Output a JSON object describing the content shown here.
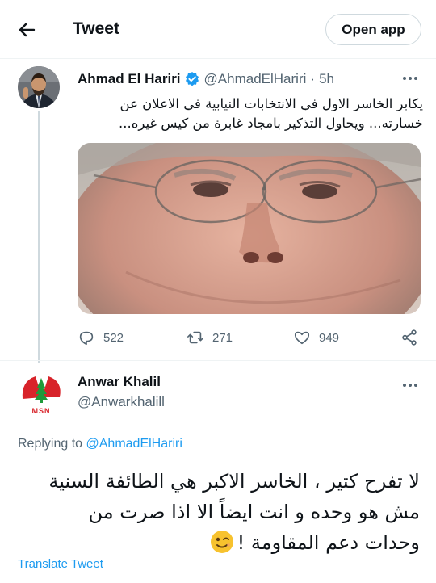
{
  "header": {
    "title": "Tweet",
    "open_app_label": "Open app"
  },
  "tweet": {
    "author_name": "Ahmad El Hariri",
    "handle": "@AhmadElHariri",
    "separator": "·",
    "time": "5h",
    "text_line1": "يكابر الخاسر الاول في الانتخابات النيابية في الاعلان عن",
    "text_line2": "خسارته... ويحاول التذكير بامجاد غابرة من كيس غيره...",
    "replies": "522",
    "retweets": "271",
    "likes": "949"
  },
  "reply": {
    "author_name": "Anwar Khalil",
    "handle": "@Anwarkhalill",
    "replying_prefix": "Replying to",
    "replying_to": "@AhmadElHariri",
    "text_line1": "لا تفرح كتير ، الخاسر الاكبر هي الطائفة السنية",
    "text_line2": "مش هو وحده و انت ايضاً  الا اذا صرت من",
    "text_line3": "وحدات دعم المقاومة !",
    "translate_label": "Translate Tweet"
  },
  "colors": {
    "accent": "#1d9bf0",
    "text": "#0f1419",
    "secondary": "#536471",
    "divider": "#eff3f4"
  },
  "icons": [
    "back-arrow-icon",
    "verified-badge-icon",
    "more-icon",
    "reply-icon",
    "retweet-icon",
    "like-icon",
    "share-icon",
    "wink-emoji-icon"
  ]
}
